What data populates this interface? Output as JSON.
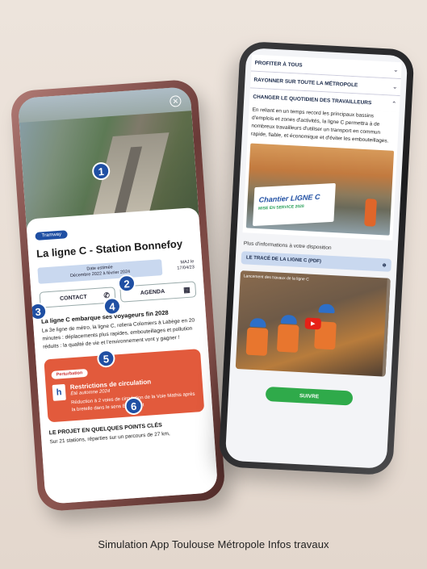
{
  "caption": "Simulation App Toulouse Métropole Infos travaux",
  "left_phone": {
    "badges": [
      "1",
      "2",
      "3",
      "4",
      "5",
      "6"
    ],
    "pill": "Tramway",
    "title": "La ligne C - Station Bonnefoy",
    "date_label": "Date estimée",
    "date_value": "Décembre 2022 à février 2024",
    "maj_label": "MAJ le",
    "maj_value": "17/04/23",
    "contact_label": "CONTACT",
    "agenda_label": "AGENDA",
    "section1_title": "La ligne C embarque ses voyageurs fin 2028",
    "section1_text": "La 3e ligne de métro, la ligne C, reliera Colomiers à Labège en 20 minutes : déplacements plus rapides, embouteillages et pollution réduits : la qualité de vie et l'environnement vont y gagner !",
    "alert": {
      "tag": "Perturbation",
      "sign": "h",
      "title": "Restrictions de circulation",
      "subtitle": "Été automne 2024",
      "text": "Réduction à 2 voies de circulation de la Voie Mathis après la bretelle dans le sens Est-Ouest"
    },
    "section2_title": "LE PROJET EN QUELQUES POINTS CLÉS",
    "section2_text": "Sur 21 stations, réparties sur un parcours de 27 km,"
  },
  "right_phone": {
    "accordions": [
      {
        "label": "PROFITER À TOUS"
      },
      {
        "label": "RAYONNER SUR TOUTE LA MÉTROPOLE"
      },
      {
        "label": "CHANGER LE QUOTIDIEN DES TRAVAILLEURS"
      }
    ],
    "open_text": "En reliant en un temps record les principaux bassins d'emplois et zones d'activités, la ligne C permettra à de nombreux travailleurs d'utiliser un transport en commun rapide, fiable, et économique et d'éviter les embouteillages.",
    "banner_title": "Chantier LIGNE C",
    "banner_sub": "MISE EN SERVICE 2028",
    "more_info": "Plus d'informations à votre disposition",
    "pdf_label": "LE TRACÉ DE LA LIGNE C (PDF)",
    "video_title": "Lancement des travaux de la ligne C",
    "follow_label": "SUIVRE"
  },
  "colors": {
    "brand_blue": "#1f4fa3",
    "alert_red": "#e25a3c",
    "follow_green": "#2faa4a"
  }
}
